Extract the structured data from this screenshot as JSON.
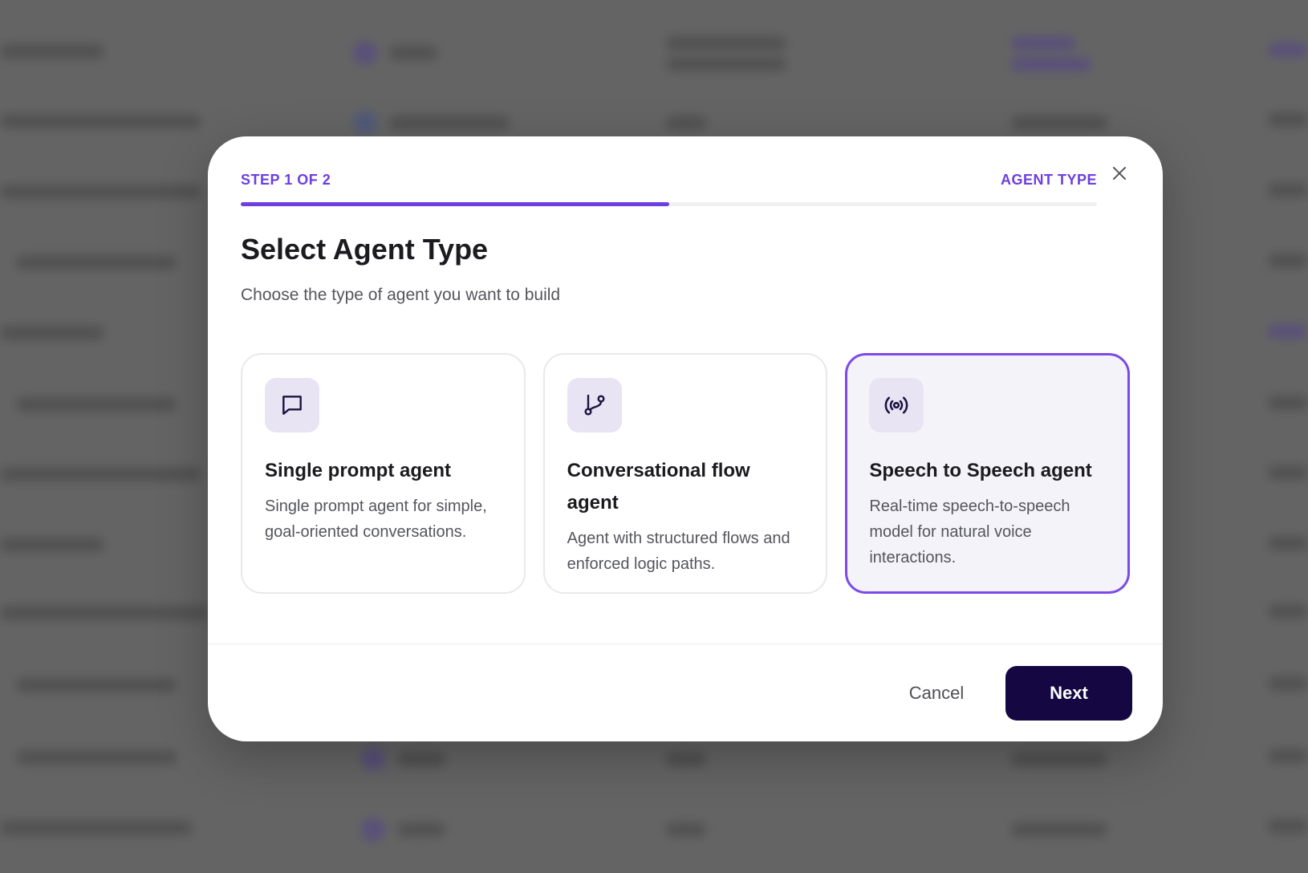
{
  "wizard": {
    "step_label": "STEP 1 OF 2",
    "step_name": "AGENT TYPE",
    "progress": 0.5,
    "title": "Select Agent Type",
    "subtitle": "Choose the type of agent you want to build"
  },
  "cards": [
    {
      "title": "Single prompt agent",
      "description": "Single prompt agent for simple, goal-oriented conversations.",
      "icon": "chat-bubble-icon",
      "selected": false
    },
    {
      "title": "Conversational flow agent",
      "description": "Agent with structured flows and enforced logic paths.",
      "icon": "git-branch-icon",
      "selected": false
    },
    {
      "title": "Speech to Speech agent",
      "description": "Real-time speech-to-speech model for natural voice interactions.",
      "icon": "broadcast-icon",
      "selected": true
    }
  ],
  "footer": {
    "cancel_label": "Cancel",
    "next_label": "Next"
  },
  "colors": {
    "accent": "#6d3fe0",
    "primary_button": "#150842",
    "selected_card_bg": "#f4f3f9",
    "icon_tile_bg": "#e8e4f3"
  }
}
